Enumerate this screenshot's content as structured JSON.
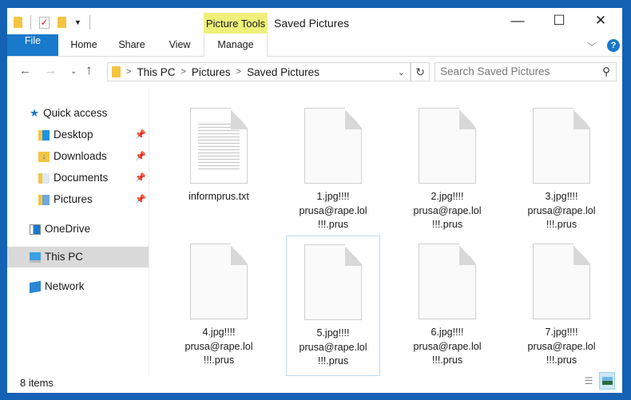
{
  "window": {
    "title": "Saved Pictures",
    "context_tab_group": "Picture Tools"
  },
  "ribbon": {
    "tabs": [
      "File",
      "Home",
      "Share",
      "View",
      "Manage"
    ],
    "help": "?"
  },
  "address": {
    "segments": [
      "This PC",
      "Pictures",
      "Saved Pictures"
    ]
  },
  "search": {
    "placeholder": "Search Saved Pictures"
  },
  "sidebar": {
    "quick_access": "Quick access",
    "items": [
      "Desktop",
      "Downloads",
      "Documents",
      "Pictures"
    ],
    "onedrive": "OneDrive",
    "thispc": "This PC",
    "network": "Network"
  },
  "files": [
    {
      "l1": "informprus.txt",
      "l2": "",
      "l3": "",
      "type": "txt"
    },
    {
      "l1": "1.jpg!!!!",
      "l2": "prusa@rape.lol",
      "l3": "!!!.prus",
      "type": "blank"
    },
    {
      "l1": "2.jpg!!!!",
      "l2": "prusa@rape.lol",
      "l3": "!!!.prus",
      "type": "blank"
    },
    {
      "l1": "3.jpg!!!!",
      "l2": "prusa@rape.lol",
      "l3": "!!!.prus",
      "type": "blank"
    },
    {
      "l1": "4.jpg!!!!",
      "l2": "prusa@rape.lol",
      "l3": "!!!.prus",
      "type": "blank"
    },
    {
      "l1": "5.jpg!!!!",
      "l2": "prusa@rape.lol",
      "l3": "!!!.prus",
      "type": "blank"
    },
    {
      "l1": "6.jpg!!!!",
      "l2": "prusa@rape.lol",
      "l3": "!!!.prus",
      "type": "blank"
    },
    {
      "l1": "7.jpg!!!!",
      "l2": "prusa@rape.lol",
      "l3": "!!!.prus",
      "type": "blank"
    }
  ],
  "status": {
    "count": "8 items"
  },
  "colors": {
    "accent": "#1979ca",
    "context_tab": "#eef07a",
    "frame": "#1561b3"
  }
}
